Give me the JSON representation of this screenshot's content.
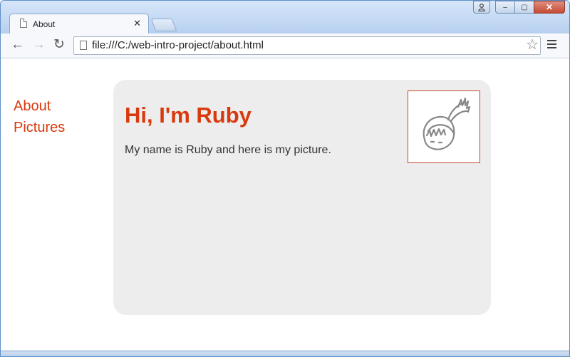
{
  "tab": {
    "title": "About",
    "close": "✕"
  },
  "window_controls": {
    "minimize": "–",
    "maximize": "▢",
    "close": "✕"
  },
  "toolbar": {
    "back": "←",
    "forward": "→",
    "reload": "↻",
    "url": "file:///C:/web-intro-project/about.html",
    "star": "☆"
  },
  "nav": {
    "items": [
      {
        "label": "About"
      },
      {
        "label": "Pictures"
      }
    ]
  },
  "main": {
    "heading": "Hi, I'm Ruby",
    "text": "My name is Ruby and here is my picture."
  },
  "colors": {
    "accent": "#d9390e",
    "card_bg": "#ededed"
  },
  "icons": [
    "page-icon",
    "close-icon",
    "back-arrow-icon",
    "forward-arrow-icon",
    "reload-icon",
    "bookmark-star-icon",
    "menu-icon",
    "user-icon",
    "ruby-avatar-icon"
  ]
}
